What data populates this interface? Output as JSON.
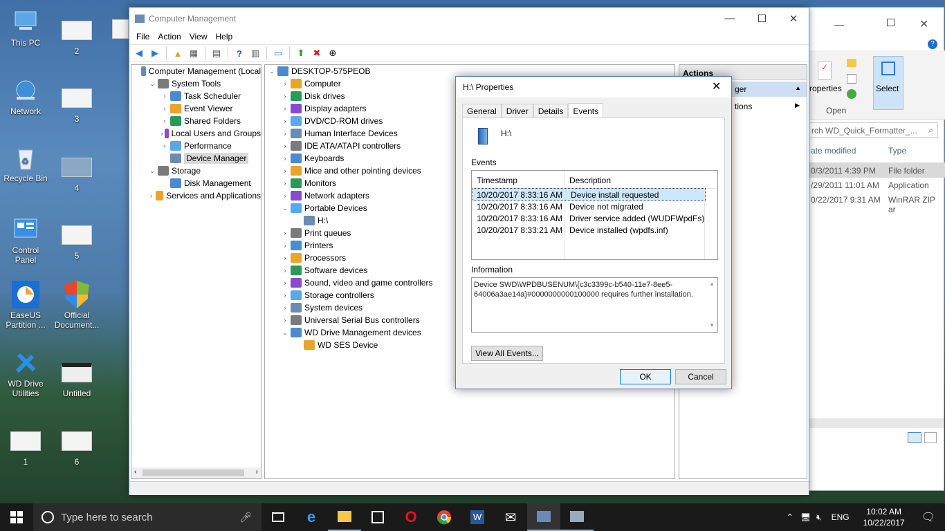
{
  "desktop": {
    "icons": [
      {
        "label": "This PC",
        "icon": "this-pc-icon"
      },
      {
        "label": "Network",
        "icon": "network-icon"
      },
      {
        "label": "Recycle Bin",
        "icon": "recycle-bin-icon"
      },
      {
        "label": "Control Panel",
        "icon": "control-panel-icon"
      },
      {
        "label": "EaseUS Partition ...",
        "icon": "easeus-icon"
      },
      {
        "label": "WD Drive Utilities",
        "icon": "wd-tools-icon"
      },
      {
        "label": "1",
        "icon": "file-thumbnail-icon"
      },
      {
        "label": "2",
        "icon": "file-thumbnail-icon"
      },
      {
        "label": "3",
        "icon": "file-thumbnail-icon"
      },
      {
        "label": "4",
        "icon": "file-thumbnail-icon"
      },
      {
        "label": "5",
        "icon": "file-thumbnail-icon"
      },
      {
        "label": "Official Document...",
        "icon": "shield-icon"
      },
      {
        "label": "Untitled",
        "icon": "file-thumbnail-icon"
      },
      {
        "label": "6",
        "icon": "file-thumbnail-icon"
      }
    ]
  },
  "explorer": {
    "ribbon": {
      "properties": "roperties",
      "open": "Open",
      "select": "Select"
    },
    "search_placeholder": "rch WD_Quick_Formatter_...",
    "columns": {
      "date": "ate modified",
      "type": "Type"
    },
    "rows": [
      {
        "date": "0/3/2011 4:39 PM",
        "type": "File folder"
      },
      {
        "date": "/29/2011 11:01 AM",
        "type": "Application"
      },
      {
        "date": "0/22/2017 9:31 AM",
        "type": "WinRAR ZIP ar"
      }
    ]
  },
  "cm": {
    "title": "Computer Management",
    "menu": [
      "File",
      "Action",
      "View",
      "Help"
    ],
    "tree": [
      {
        "label": "Computer Management (Local",
        "level": 0,
        "exp": ""
      },
      {
        "label": "System Tools",
        "level": 1,
        "exp": "v"
      },
      {
        "label": "Task Scheduler",
        "level": 2,
        "exp": ">"
      },
      {
        "label": "Event Viewer",
        "level": 2,
        "exp": ">"
      },
      {
        "label": "Shared Folders",
        "level": 2,
        "exp": ">"
      },
      {
        "label": "Local Users and Groups",
        "level": 2,
        "exp": ">"
      },
      {
        "label": "Performance",
        "level": 2,
        "exp": ">"
      },
      {
        "label": "Device Manager",
        "level": 2,
        "exp": "",
        "selected": true
      },
      {
        "label": "Storage",
        "level": 1,
        "exp": "v"
      },
      {
        "label": "Disk Management",
        "level": 2,
        "exp": ""
      },
      {
        "label": "Services and Applications",
        "level": 1,
        "exp": ">"
      }
    ],
    "devices": [
      {
        "label": "DESKTOP-575PEOB",
        "level": 0,
        "exp": "v"
      },
      {
        "label": "Computer",
        "level": 1,
        "exp": ">"
      },
      {
        "label": "Disk drives",
        "level": 1,
        "exp": ">"
      },
      {
        "label": "Display adapters",
        "level": 1,
        "exp": ">"
      },
      {
        "label": "DVD/CD-ROM drives",
        "level": 1,
        "exp": ">"
      },
      {
        "label": "Human Interface Devices",
        "level": 1,
        "exp": ">"
      },
      {
        "label": "IDE ATA/ATAPI controllers",
        "level": 1,
        "exp": ">"
      },
      {
        "label": "Keyboards",
        "level": 1,
        "exp": ">"
      },
      {
        "label": "Mice and other pointing devices",
        "level": 1,
        "exp": ">"
      },
      {
        "label": "Monitors",
        "level": 1,
        "exp": ">"
      },
      {
        "label": "Network adapters",
        "level": 1,
        "exp": ">"
      },
      {
        "label": "Portable Devices",
        "level": 1,
        "exp": "v"
      },
      {
        "label": "H:\\",
        "level": 2,
        "exp": ""
      },
      {
        "label": "Print queues",
        "level": 1,
        "exp": ">"
      },
      {
        "label": "Printers",
        "level": 1,
        "exp": ">"
      },
      {
        "label": "Processors",
        "level": 1,
        "exp": ">"
      },
      {
        "label": "Software devices",
        "level": 1,
        "exp": ">"
      },
      {
        "label": "Sound, video and game controllers",
        "level": 1,
        "exp": ">"
      },
      {
        "label": "Storage controllers",
        "level": 1,
        "exp": ">"
      },
      {
        "label": "System devices",
        "level": 1,
        "exp": ">"
      },
      {
        "label": "Universal Serial Bus controllers",
        "level": 1,
        "exp": ">"
      },
      {
        "label": "WD Drive Management devices",
        "level": 1,
        "exp": "v"
      },
      {
        "label": "WD SES Device",
        "level": 2,
        "exp": ""
      }
    ],
    "actions": {
      "title": "Actions",
      "item1": "ger",
      "item2": "tions"
    }
  },
  "dialog": {
    "title": "H:\\ Properties",
    "tabs": [
      "General",
      "Driver",
      "Details",
      "Events"
    ],
    "active_tab": "Events",
    "device_name": "H:\\",
    "events_label": "Events",
    "columns": {
      "timestamp": "Timestamp",
      "description": "Description"
    },
    "events": [
      {
        "timestamp": "10/20/2017 8:33:16 AM",
        "description": "Device install requested"
      },
      {
        "timestamp": "10/20/2017 8:33:16 AM",
        "description": "Device not migrated"
      },
      {
        "timestamp": "10/20/2017 8:33:16 AM",
        "description": "Driver service added (WUDFWpdFs)"
      },
      {
        "timestamp": "10/20/2017 8:33:21 AM",
        "description": "Device installed (wpdfs.inf)"
      }
    ],
    "information_label": "Information",
    "information": "Device SWD\\WPDBUSENUM\\{c3c3399c-b540-11e7-8ee5-64006a3ae14a}#0000000000100000 requires further installation.",
    "view_all": "View All Events...",
    "ok": "OK",
    "cancel": "Cancel"
  },
  "taskbar": {
    "search_placeholder": "Type here to search",
    "lang": "ENG",
    "time": "10:02 AM",
    "date": "10/22/2017"
  }
}
